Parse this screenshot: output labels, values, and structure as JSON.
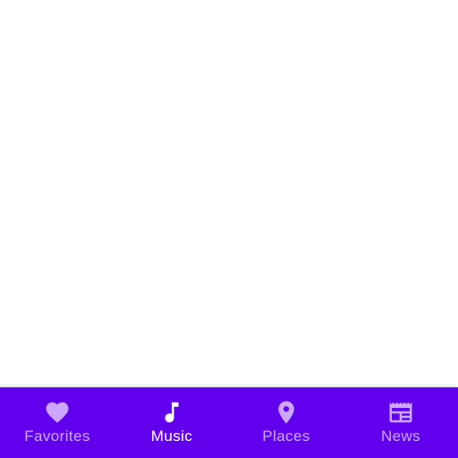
{
  "colors": {
    "nav_background": "#6200EE",
    "active": "#FFFFFF",
    "inactive": "#CBA7FF",
    "content_background": "#FFFFFF"
  },
  "bottom_nav": {
    "selected_index": 1,
    "items": [
      {
        "label": "Favorites",
        "icon": "heart-icon",
        "active": false
      },
      {
        "label": "Music",
        "icon": "music-note-icon",
        "active": true
      },
      {
        "label": "Places",
        "icon": "location-pin-icon",
        "active": false
      },
      {
        "label": "News",
        "icon": "newspaper-icon",
        "active": false
      }
    ]
  }
}
